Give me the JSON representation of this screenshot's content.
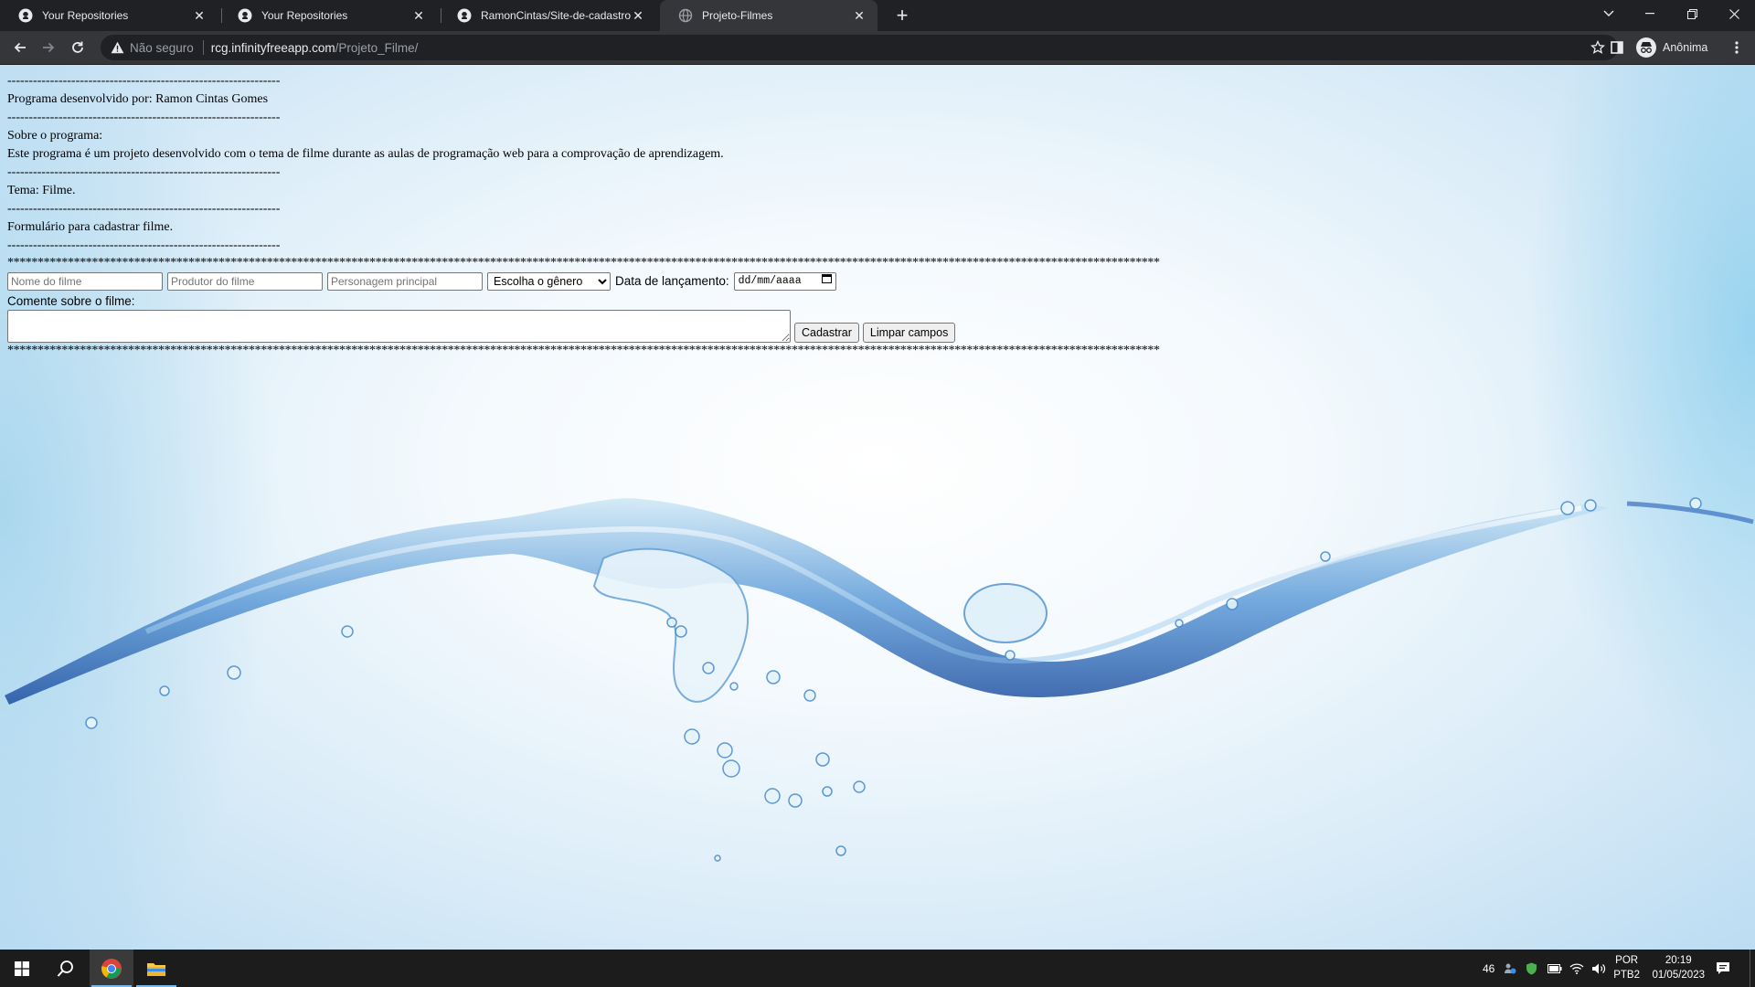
{
  "browser": {
    "tabs": [
      {
        "title": "Your Repositories",
        "icon": "github-icon",
        "active": false
      },
      {
        "title": "Your Repositories",
        "icon": "github-icon",
        "active": false
      },
      {
        "title": "RamonCintas/Site-de-cadastro-d",
        "icon": "github-icon",
        "active": false
      },
      {
        "title": "Projeto-Filmes",
        "icon": "globe-icon",
        "active": true
      }
    ],
    "security_label": "Não seguro",
    "url_host": "rcg.infinityfreeapp.com",
    "url_path": "/Projeto_Filme/",
    "profile_label": "Anônima"
  },
  "page": {
    "dash_line": "----------------------------------------------------------------",
    "developer": "Programa desenvolvido por: Ramon Cintas Gomes",
    "about_heading": "Sobre o programa:",
    "about_text": "Este programa é um projeto desenvolvido com o tema de filme durante as aulas de programação web para a comprovação de aprendizagem.",
    "theme": "Tema: Filme.",
    "form_title": "Formulário para cadastrar filme.",
    "star_line": "***********************************************************************************************************************************************************************************************",
    "form": {
      "movie_name_placeholder": "Nome do filme",
      "producer_placeholder": "Produtor do filme",
      "character_placeholder": "Personagem principal",
      "genre_selected": "Escolha o gênero",
      "release_date_label": "Data de lançamento:",
      "date_placeholder": "dd/mm/aaaa",
      "comment_label": "Comente sobre o filme:",
      "submit_label": "Cadastrar",
      "clear_label": "Limpar campos"
    }
  },
  "taskbar": {
    "temperature": "46",
    "lang_top": "POR",
    "lang_bottom": "PTB2",
    "time": "20:19",
    "date": "01/05/2023"
  }
}
